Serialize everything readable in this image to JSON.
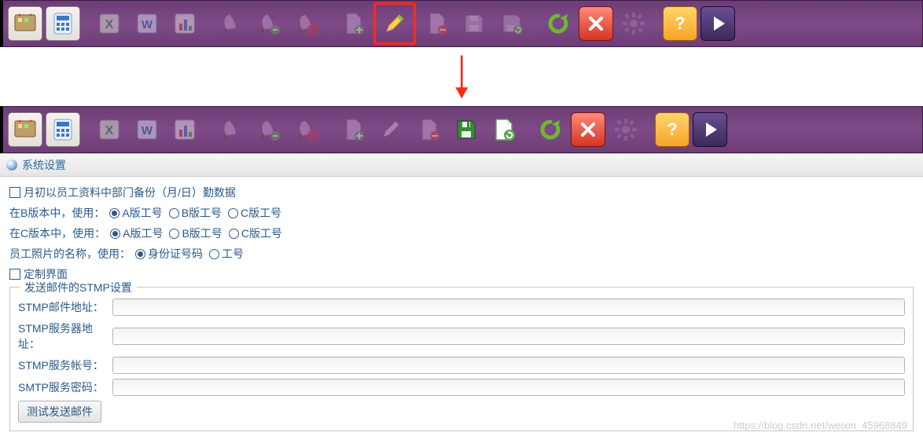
{
  "section_title": "系统设置",
  "checkbox_backup": "月初以员工资料中部门备份（月/日）勤数据",
  "row_b": {
    "label": "在B版本中，使用：",
    "opts": [
      "A版工号",
      "B版工号",
      "C版工号"
    ],
    "selected": 0
  },
  "row_c": {
    "label": "在C版本中，使用：",
    "opts": [
      "A版工号",
      "B版工号",
      "C版工号"
    ],
    "selected": 0
  },
  "row_photo": {
    "label": "员工照片的名称，使用：",
    "opts": [
      "身份证号码",
      "工号"
    ],
    "selected": 0
  },
  "checkbox_custom_ui": "定制界面",
  "smtp": {
    "legend": "发送邮件的STMP设置",
    "addr_label": "STMP邮件地址：",
    "server_label": "STMP服务器地址：",
    "account_label": "STMP服务帐号：",
    "password_label": "SMTP服务密码：",
    "addr": "",
    "server": "",
    "account": "",
    "password": ""
  },
  "test_button": "测试发送邮件",
  "watermark": "https://blog.csdn.net/weixin_45968849",
  "icons": {
    "board": "board-icon",
    "calc": "calc-icon",
    "excel": "excel-icon",
    "word": "word-icon",
    "chart": "chart-icon",
    "bell1": "bell-icon",
    "bell2": "bell-minus-icon",
    "bell3": "bell-block-icon",
    "doc-add": "doc-add-icon",
    "pencil": "pencil-icon",
    "doc-del": "doc-delete-icon",
    "save": "save-icon",
    "save-as": "save-refresh-icon",
    "refresh": "refresh-icon",
    "close": "close-icon",
    "gear": "gear-icon",
    "help": "help-icon",
    "play": "play-icon"
  }
}
